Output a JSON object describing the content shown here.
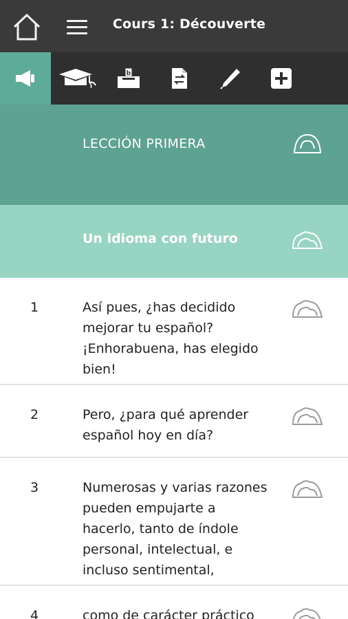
{
  "header": {
    "title": "Cours 1: Découverte"
  },
  "toolbar": {
    "tools": [
      {
        "name": "listen",
        "icon": "megaphone-icon"
      },
      {
        "name": "learn",
        "icon": "graduation-cap-icon"
      },
      {
        "name": "vote",
        "icon": "ballot-box-icon"
      },
      {
        "name": "translate",
        "icon": "document-swap-icon"
      },
      {
        "name": "write",
        "icon": "pen-icon"
      },
      {
        "name": "more",
        "icon": "plus-square-icon"
      }
    ],
    "active_index": 0
  },
  "lesson": {
    "title": "LECCIÓN PRIMERA",
    "subtitle": "Un idioma con futuro"
  },
  "items": [
    {
      "number": "1",
      "text": "Así pues, ¿has decidido mejorar tu español? ¡Enhorabuena, has elegido bien!"
    },
    {
      "number": "2",
      "text": "Pero, ¿para qué aprender español hoy en día?"
    },
    {
      "number": "3",
      "text": "Numerosas y varias razones pueden empujarte a hacerlo, tanto de índole personal, intelectual, e incluso sentimental,"
    },
    {
      "number": "4",
      "text": "como de carácter práctico"
    }
  ],
  "colors": {
    "topbar": "#3a3a3a",
    "toolbar": "#2f2f2f",
    "accent": "#5fab9a",
    "lesson_head": "#5ea392",
    "sub_head": "#98d4c2"
  }
}
